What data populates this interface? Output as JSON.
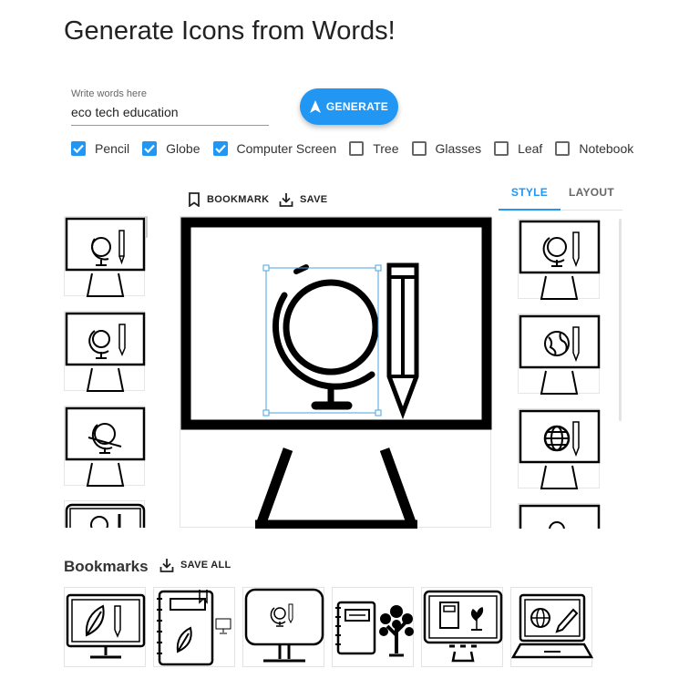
{
  "title": "Generate Icons from Words!",
  "input": {
    "label": "Write words here",
    "value": "eco tech education"
  },
  "generate_label": "GENERATE",
  "checkboxes": [
    {
      "label": "Pencil",
      "checked": true
    },
    {
      "label": "Globe",
      "checked": true
    },
    {
      "label": "Computer Screen",
      "checked": true
    },
    {
      "label": "Tree",
      "checked": false
    },
    {
      "label": "Glasses",
      "checked": false
    },
    {
      "label": "Leaf",
      "checked": false
    },
    {
      "label": "Notebook",
      "checked": false
    }
  ],
  "toolbar": {
    "bookmark_label": "BOOKMARK",
    "save_label": "SAVE"
  },
  "tabs": {
    "style": "STYLE",
    "layout": "LAYOUT",
    "active": "STYLE"
  },
  "bookmarks": {
    "heading": "Bookmarks",
    "save_all_label": "SAVE ALL"
  },
  "colors": {
    "accent": "#2196f3",
    "text": "#222222"
  }
}
